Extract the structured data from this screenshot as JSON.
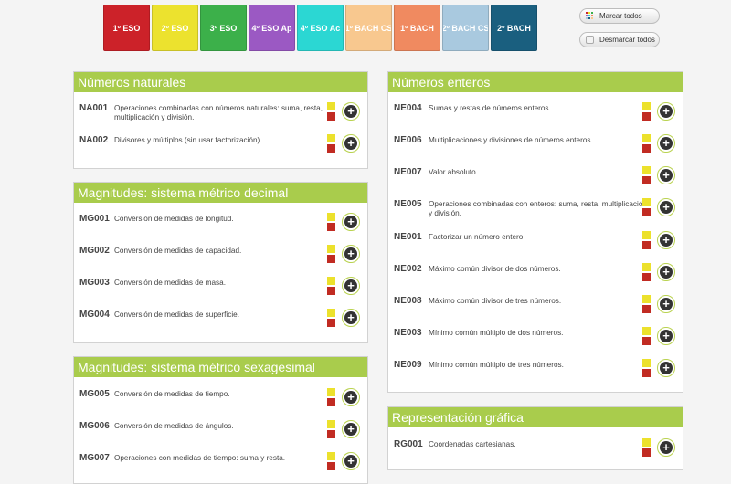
{
  "levels": [
    {
      "label": "1º ESO",
      "color": "#cc2229"
    },
    {
      "label": "2º ESO",
      "color": "#ece22e"
    },
    {
      "label": "3º ESO",
      "color": "#3cb04a"
    },
    {
      "label": "4º ESO Ap",
      "color": "#9b59c3"
    },
    {
      "label": "4º ESO Ac",
      "color": "#2bd7d3"
    },
    {
      "label": "1º BACH CS",
      "color": "#f8c88f"
    },
    {
      "label": "1º BACH",
      "color": "#f08a60"
    },
    {
      "label": "2º BACH CS",
      "color": "#a9c9df"
    },
    {
      "label": "2º BACH",
      "color": "#1a5f7f"
    }
  ],
  "controls": {
    "mark_all": "Marcar todos",
    "unmark_all": "Desmarcar todos"
  },
  "sections": {
    "naturales": {
      "title": "Números naturales",
      "items": [
        {
          "code": "NA001",
          "text": "Operaciones combinadas con números naturales: suma, resta, multiplicación y división."
        },
        {
          "code": "NA002",
          "text": "Divisores y múltiplos (sin usar factorización)."
        }
      ]
    },
    "decimal": {
      "title": "Magnitudes: sistema métrico decimal",
      "items": [
        {
          "code": "MG001",
          "text": "Conversión de medidas de longitud."
        },
        {
          "code": "MG002",
          "text": "Conversión de medidas de capacidad."
        },
        {
          "code": "MG003",
          "text": "Conversión de medidas de masa."
        },
        {
          "code": "MG004",
          "text": "Conversión de medidas de superficie."
        }
      ]
    },
    "sexagesimal": {
      "title": "Magnitudes: sistema métrico sexagesimal",
      "items": [
        {
          "code": "MG005",
          "text": "Conversión de medidas de tiempo."
        },
        {
          "code": "MG006",
          "text": "Conversión de medidas de ángulos."
        },
        {
          "code": "MG007",
          "text": "Operaciones con medidas de tiempo: suma y resta."
        }
      ]
    },
    "enteros": {
      "title": "Números enteros",
      "items": [
        {
          "code": "NE004",
          "text": "Sumas y restas de números enteros."
        },
        {
          "code": "NE006",
          "text": "Multiplicaciones y divisiones de números enteros."
        },
        {
          "code": "NE007",
          "text": "Valor absoluto."
        },
        {
          "code": "NE005",
          "text": "Operaciones combinadas con enteros: suma, resta, multiplicación y división."
        },
        {
          "code": "NE001",
          "text": "Factorizar un número entero."
        },
        {
          "code": "NE002",
          "text": "Máximo común divisor de dos números."
        },
        {
          "code": "NE008",
          "text": "Máximo común divisor de tres números."
        },
        {
          "code": "NE003",
          "text": "Mínimo común múltiplo de dos números."
        },
        {
          "code": "NE009",
          "text": "Mínimo común múltiplo de tres números."
        }
      ]
    },
    "grafica": {
      "title": "Representación gráfica",
      "items": [
        {
          "code": "RG001",
          "text": "Coordenadas cartesianas."
        }
      ]
    }
  }
}
